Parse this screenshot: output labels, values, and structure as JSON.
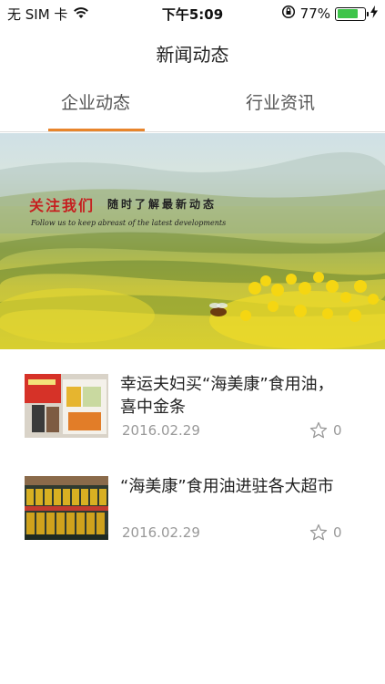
{
  "status_bar": {
    "carrier": "无 SIM 卡",
    "time": "下午5:09",
    "battery_percent_label": "77%",
    "battery_level": 0.77,
    "icons": [
      "wifi-icon",
      "rotation-lock-icon",
      "battery-icon",
      "charging-icon"
    ]
  },
  "nav": {
    "title": "新闻动态"
  },
  "tabs": [
    {
      "label": "企业动态",
      "selected": true
    },
    {
      "label": "行业资讯",
      "selected": false
    }
  ],
  "banner": {
    "title": "关注我们",
    "title_secondary": "随时了解最新动态",
    "subtitle": "Follow us to keep abreast of the latest developments"
  },
  "news": [
    {
      "title": " 幸运夫妇买“海美康”食用油，喜中金条",
      "date": "2016.02.29",
      "favorites": "0"
    },
    {
      "title": "“海美康”食用油进驻各大超市",
      "date": "2016.02.29",
      "favorites": "0"
    }
  ],
  "colors": {
    "accent": "#e8852c",
    "battery_green": "#3ec44a"
  }
}
